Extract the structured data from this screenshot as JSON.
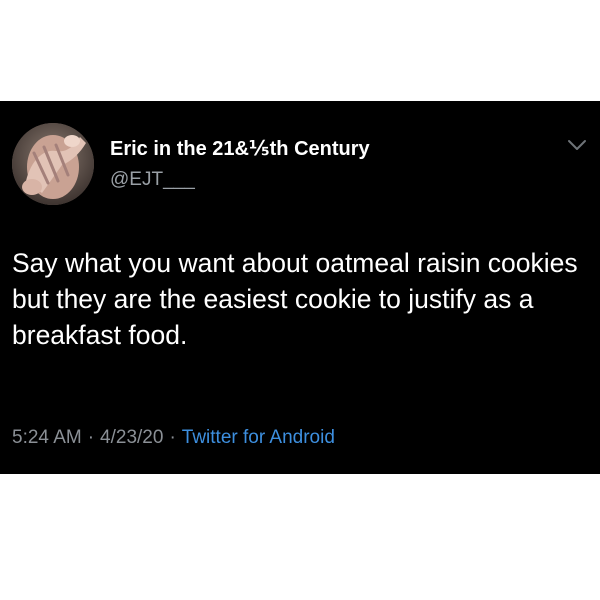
{
  "tweet": {
    "display_name": "Eric in the 21&⅕th Century",
    "handle": "@EJT___",
    "text": "Say what you want about oatmeal raisin cookies but they are the easiest cookie to justify as a breakfast food.",
    "time": "5:24 AM",
    "separator": "·",
    "date": "4/23/20",
    "source": "Twitter for Android"
  },
  "icons": {
    "avatar": "hand-over-face-avatar",
    "menu": "chevron-down-icon"
  },
  "colors": {
    "background": "#000000",
    "text": "#ffffff",
    "secondary": "#8b9096",
    "link": "#3d8fdf"
  }
}
